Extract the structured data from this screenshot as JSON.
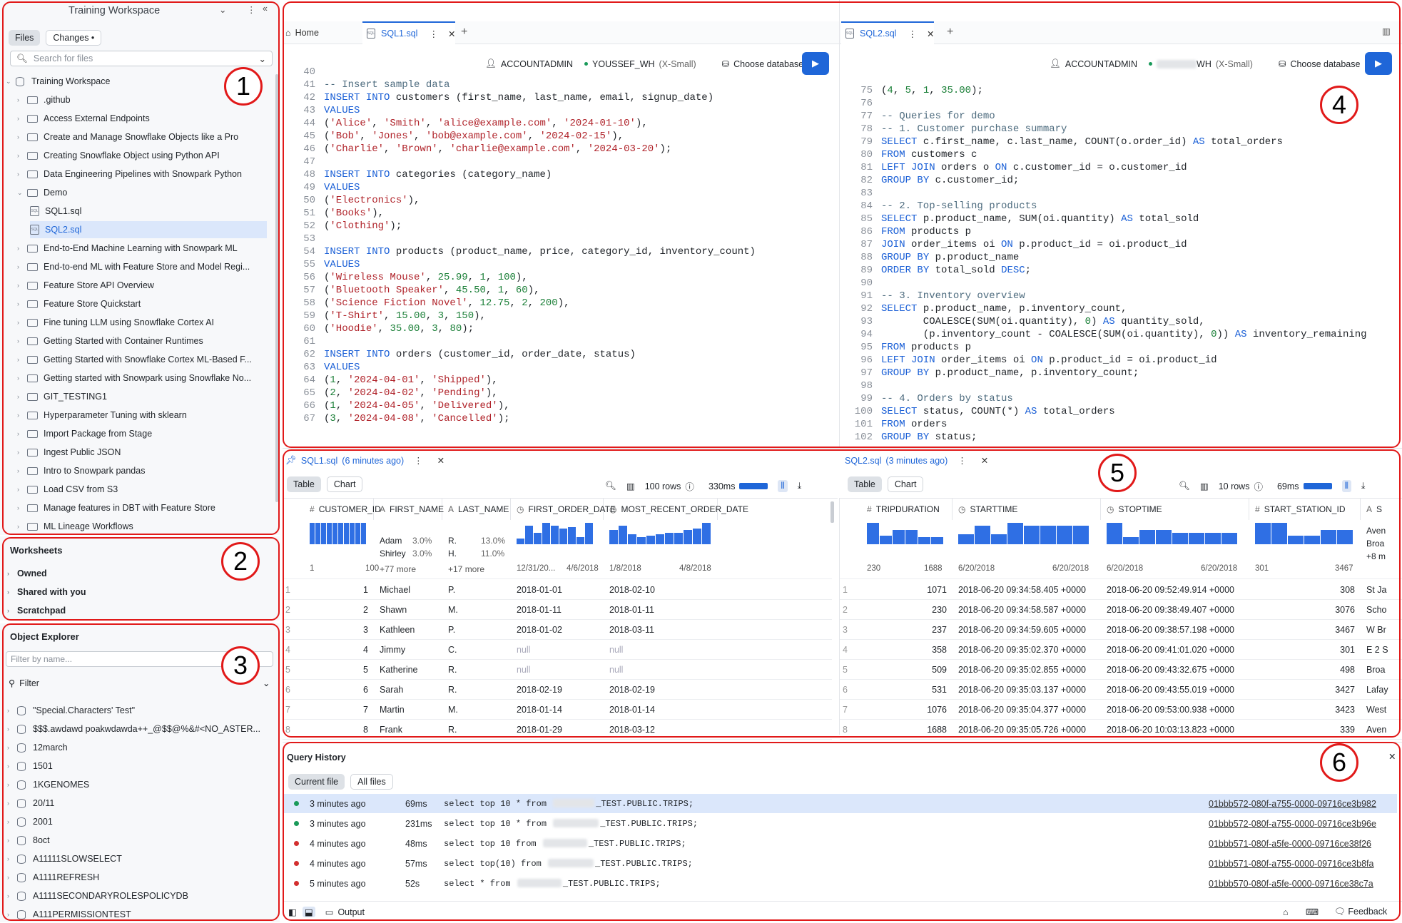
{
  "workspace": {
    "title": "Training Workspace",
    "tabs": [
      "Files",
      "Changes"
    ],
    "search_placeholder": "Search for files",
    "root": "Training Workspace",
    "items": [
      ".github",
      "Access External Endpoints",
      "Create and Manage Snowflake Objects like a Pro",
      "Creating Snowflake Object using Python API",
      "Data Engineering Pipelines with Snowpark Python",
      "Demo",
      "SQL1.sql",
      "SQL2.sql",
      "End-to-End Machine Learning with Snowpark ML",
      "End-to-end ML with Feature Store and Model Regi...",
      "Feature Store API Overview",
      "Feature Store Quickstart",
      "Fine tuning LLM using Snowflake Cortex AI",
      "Getting Started with Container Runtimes",
      "Getting Started with Snowflake Cortex ML-Based F...",
      "Getting started with Snowpark using Snowflake No...",
      "GIT_TESTING1",
      "Hyperparameter Tuning with sklearn",
      "Import Package from Stage",
      "Ingest Public JSON",
      "Intro to Snowpark pandas",
      "Load CSV from S3",
      "Manage features in DBT with Feature Store",
      "ML Lineage Workflows"
    ]
  },
  "worksheets": {
    "title": "Worksheets",
    "items": [
      "Owned",
      "Shared with you",
      "Scratchpad"
    ]
  },
  "explorer": {
    "title": "Object Explorer",
    "filter_placeholder": "Filter by name...",
    "filter_label": "Filter",
    "items": [
      "\"Special.Characters' Test\"",
      "$$$.awdawd poakwdawda++_@$$@%&#<NO_ASTER...",
      "12march",
      "1501",
      "1KGENOMES",
      "20/11",
      "2001",
      "8oct",
      "A11111SLOWSELECT",
      "A1111REFRESH",
      "A1111SECONDARYROLESPOLICYDB",
      "A111PERMISSIONTEST"
    ]
  },
  "editor_left": {
    "tabs": [
      "Home",
      "SQL1.sql"
    ],
    "role": "ACCOUNTADMIN",
    "warehouse": "YOUSSEF_WH",
    "size": "(X-Small)",
    "database": "Choose database",
    "lines": [
      [
        "40",
        ""
      ],
      [
        "41",
        "-- Insert sample data"
      ],
      [
        "42",
        "INSERT INTO customers (first_name, last_name, email, signup_date)"
      ],
      [
        "43",
        "VALUES"
      ],
      [
        "44",
        "('Alice', 'Smith', 'alice@example.com', '2024-01-10'),"
      ],
      [
        "45",
        "('Bob', 'Jones', 'bob@example.com', '2024-02-15'),"
      ],
      [
        "46",
        "('Charlie', 'Brown', 'charlie@example.com', '2024-03-20');"
      ],
      [
        "47",
        ""
      ],
      [
        "48",
        "INSERT INTO categories (category_name)"
      ],
      [
        "49",
        "VALUES"
      ],
      [
        "50",
        "('Electronics'),"
      ],
      [
        "51",
        "('Books'),"
      ],
      [
        "52",
        "('Clothing');"
      ],
      [
        "53",
        ""
      ],
      [
        "54",
        "INSERT INTO products (product_name, price, category_id, inventory_count)"
      ],
      [
        "55",
        "VALUES"
      ],
      [
        "56",
        "('Wireless Mouse', 25.99, 1, 100),"
      ],
      [
        "57",
        "('Bluetooth Speaker', 45.50, 1, 60),"
      ],
      [
        "58",
        "('Science Fiction Novel', 12.75, 2, 200),"
      ],
      [
        "59",
        "('T-Shirt', 15.00, 3, 150),"
      ],
      [
        "60",
        "('Hoodie', 35.00, 3, 80);"
      ],
      [
        "61",
        ""
      ],
      [
        "62",
        "INSERT INTO orders (customer_id, order_date, status)"
      ],
      [
        "63",
        "VALUES"
      ],
      [
        "64",
        "(1, '2024-04-01', 'Shipped'),"
      ],
      [
        "65",
        "(2, '2024-04-02', 'Pending'),"
      ],
      [
        "66",
        "(1, '2024-04-05', 'Delivered'),"
      ],
      [
        "67",
        "(3, '2024-04-08', 'Cancelled');"
      ]
    ]
  },
  "editor_right": {
    "tabs": [
      "SQL2.sql"
    ],
    "role": "ACCOUNTADMIN",
    "warehouse": "WH",
    "size": "(X-Small)",
    "database": "Choose database",
    "lines": [
      [
        "75",
        "(4, 5, 1, 35.00);"
      ],
      [
        "76",
        ""
      ],
      [
        "77",
        "-- Queries for demo"
      ],
      [
        "78",
        "-- 1. Customer purchase summary"
      ],
      [
        "79",
        "SELECT c.first_name, c.last_name, COUNT(o.order_id) AS total_orders"
      ],
      [
        "80",
        "FROM customers c"
      ],
      [
        "81",
        "LEFT JOIN orders o ON c.customer_id = o.customer_id"
      ],
      [
        "82",
        "GROUP BY c.customer_id;"
      ],
      [
        "83",
        ""
      ],
      [
        "84",
        "-- 2. Top-selling products"
      ],
      [
        "85",
        "SELECT p.product_name, SUM(oi.quantity) AS total_sold"
      ],
      [
        "86",
        "FROM products p"
      ],
      [
        "87",
        "JOIN order_items oi ON p.product_id = oi.product_id"
      ],
      [
        "88",
        "GROUP BY p.product_name"
      ],
      [
        "89",
        "ORDER BY total_sold DESC;"
      ],
      [
        "90",
        ""
      ],
      [
        "91",
        "-- 3. Inventory overview"
      ],
      [
        "92",
        "SELECT p.product_name, p.inventory_count,"
      ],
      [
        "93",
        "       COALESCE(SUM(oi.quantity), 0) AS quantity_sold,"
      ],
      [
        "94",
        "       (p.inventory_count - COALESCE(SUM(oi.quantity), 0)) AS inventory_remaining"
      ],
      [
        "95",
        "FROM products p"
      ],
      [
        "96",
        "LEFT JOIN order_items oi ON p.product_id = oi.product_id"
      ],
      [
        "97",
        "GROUP BY p.product_name, p.inventory_count;"
      ],
      [
        "98",
        ""
      ],
      [
        "99",
        "-- 4. Orders by status"
      ],
      [
        "100",
        "SELECT status, COUNT(*) AS total_orders"
      ],
      [
        "101",
        "FROM orders"
      ],
      [
        "102",
        "GROUP BY status;"
      ]
    ]
  },
  "result_left": {
    "tab": "SQL1.sql",
    "age": "(6 minutes ago)",
    "views": [
      "Table",
      "Chart"
    ],
    "rows": "100 rows",
    "time": "330ms",
    "columns": [
      "CUSTOMER_ID",
      "FIRST_NAME",
      "LAST_NAME",
      "FIRST_ORDER_DATE",
      "MOST_RECENT_ORDER_DATE"
    ],
    "stats": {
      "id_range": [
        "1",
        "100"
      ],
      "first_top": [
        [
          "Adam",
          "3.0%"
        ],
        [
          "Shirley",
          "3.0%"
        ]
      ],
      "first_more": "+77 more",
      "last_top": [
        [
          "R.",
          "13.0%"
        ],
        [
          "H.",
          "11.0%"
        ]
      ],
      "last_more": "+17 more",
      "fod_range": [
        "12/31/20...",
        "4/6/2018"
      ],
      "mrod_range": [
        "1/8/2018",
        "4/8/2018"
      ]
    },
    "data": [
      [
        "1",
        "1",
        "Michael",
        "P.",
        "2018-01-01",
        "2018-02-10"
      ],
      [
        "2",
        "2",
        "Shawn",
        "M.",
        "2018-01-11",
        "2018-01-11"
      ],
      [
        "3",
        "3",
        "Kathleen",
        "P.",
        "2018-01-02",
        "2018-03-11"
      ],
      [
        "4",
        "4",
        "Jimmy",
        "C.",
        "null",
        "null"
      ],
      [
        "5",
        "5",
        "Katherine",
        "R.",
        "null",
        "null"
      ],
      [
        "6",
        "6",
        "Sarah",
        "R.",
        "2018-02-19",
        "2018-02-19"
      ],
      [
        "7",
        "7",
        "Martin",
        "M.",
        "2018-01-14",
        "2018-01-14"
      ],
      [
        "8",
        "8",
        "Frank",
        "R.",
        "2018-01-29",
        "2018-03-12"
      ]
    ]
  },
  "result_right": {
    "tab": "SQL2.sql",
    "age": "(3 minutes ago)",
    "views": [
      "Table",
      "Chart"
    ],
    "rows": "10 rows",
    "time": "69ms",
    "columns": [
      "TRIPDURATION",
      "STARTTIME",
      "STOPTIME",
      "START_STATION_ID",
      "S"
    ],
    "stats": {
      "dur_range": [
        "230",
        "1688"
      ],
      "start_range": [
        "6/20/2018",
        "6/20/2018"
      ],
      "stop_range": [
        "6/20/2018",
        "6/20/2018"
      ],
      "sid_range": [
        "301",
        "3467"
      ],
      "name_top": [
        "Aven",
        "Broa",
        "+8 m"
      ]
    },
    "data": [
      [
        "1",
        "1071",
        "2018-06-20 09:34:58.405 +0000",
        "2018-06-20 09:52:49.914 +0000",
        "308",
        "St Ja"
      ],
      [
        "2",
        "230",
        "2018-06-20 09:34:58.587 +0000",
        "2018-06-20 09:38:49.407 +0000",
        "3076",
        "Scho"
      ],
      [
        "3",
        "237",
        "2018-06-20 09:34:59.605 +0000",
        "2018-06-20 09:38:57.198 +0000",
        "3467",
        "W Br"
      ],
      [
        "4",
        "358",
        "2018-06-20 09:35:02.370 +0000",
        "2018-06-20 09:41:01.020 +0000",
        "301",
        "E 2 S"
      ],
      [
        "5",
        "509",
        "2018-06-20 09:35:02.855 +0000",
        "2018-06-20 09:43:32.675 +0000",
        "498",
        "Broa"
      ],
      [
        "6",
        "531",
        "2018-06-20 09:35:03.137 +0000",
        "2018-06-20 09:43:55.019 +0000",
        "3427",
        "Lafay"
      ],
      [
        "7",
        "1076",
        "2018-06-20 09:35:04.377 +0000",
        "2018-06-20 09:53:00.938 +0000",
        "3423",
        "West"
      ],
      [
        "8",
        "1688",
        "2018-06-20 09:35:05.726 +0000",
        "2018-06-20 10:03:13.823 +0000",
        "339",
        "Aven"
      ]
    ]
  },
  "history": {
    "title": "Query History",
    "filters": [
      "Current file",
      "All files"
    ],
    "rows": [
      {
        "when": "3 minutes ago",
        "dur": "69ms",
        "q1": "select top 10 * from ",
        "q2": "_TEST.PUBLIC.TRIPS;",
        "id": "01bbb572-080f-a755-0000-09716ce3b982",
        "status": "#1a9a5a"
      },
      {
        "when": "3 minutes ago",
        "dur": "231ms",
        "q1": "select top 10 * from ",
        "q2": "_TEST.PUBLIC.TRIPS;",
        "id": "01bbb572-080f-a755-0000-09716ce3b96e",
        "status": "#1a9a5a"
      },
      {
        "when": "4 minutes ago",
        "dur": "48ms",
        "q1": "select top 10 from ",
        "q2": "_TEST.PUBLIC.TRIPS;",
        "id": "01bbb571-080f-a5fe-0000-09716ce38f26",
        "status": "#d32f2f"
      },
      {
        "when": "4 minutes ago",
        "dur": "57ms",
        "q1": "select top(10) from ",
        "q2": "_TEST.PUBLIC.TRIPS;",
        "id": "01bbb571-080f-a755-0000-09716ce3b8fa",
        "status": "#d32f2f"
      },
      {
        "when": "5 minutes ago",
        "dur": "52s",
        "q1": "select * from ",
        "q2": "_TEST.PUBLIC.TRIPS;",
        "id": "01bbb570-080f-a5fe-0000-09716ce38c7a",
        "status": "#d32f2f"
      }
    ]
  },
  "footer": {
    "output": "Output",
    "feedback": "Feedback"
  },
  "badges": [
    "1",
    "2",
    "3",
    "4",
    "5",
    "6"
  ]
}
